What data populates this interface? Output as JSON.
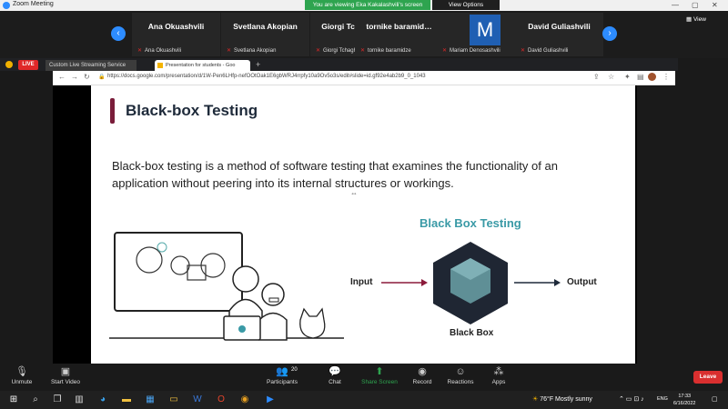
{
  "zoom": {
    "window_title": "Zoom Meeting",
    "viewing_banner": "You are viewing Eka Kakalashvili's screen",
    "view_options": "View Options",
    "view_label": "View",
    "leave_label": "Leave"
  },
  "participants": [
    {
      "name": "Ana Okuashvili",
      "sub": "Ana Okuashvili"
    },
    {
      "name": "Svetlana Akopian",
      "sub": "Svetlana Akopian"
    },
    {
      "name": "Giorgi Tchaghia…",
      "sub": "Giorgi Tchaghiashvili"
    },
    {
      "name": "tornike baramid…",
      "sub": "tornike baramidze"
    },
    {
      "name": "M",
      "sub": "Mariam Denosashvili"
    },
    {
      "name": "David Guliashvili",
      "sub": "David Guliashvili"
    }
  ],
  "browser": {
    "live_badge": "LIVE",
    "tab1_label": "Custom Live Streaming Service",
    "tab2_label": "Presentation for students - Goo",
    "url": "https://docs.google.com/presentation/d/1W-Pen6LHfp-nefOOtOak1E6gbWRJ4rrpfy10a9Ov5o3s/edit#slide=id.gf92e4ab2b9_0_1043"
  },
  "slide": {
    "title": "Black-box Testing",
    "body": "Black-box testing is a method of software testing that examines the functionality of an application without peering into its internal structures or workings.",
    "diagram_title": "Black Box Testing",
    "input_label": "Input",
    "output_label": "Output",
    "box_label": "Black Box",
    "colors": {
      "accent": "#7a1d3a",
      "diagram_title": "#3a9aa6",
      "input_arrow": "#8b1a3a",
      "output_arrow": "#1e2a3a"
    }
  },
  "toolbar": {
    "unmute": "Unmute",
    "start_video": "Start Video",
    "participants": "Participants",
    "participant_count": "20",
    "chat": "Chat",
    "share_screen": "Share Screen",
    "record": "Record",
    "reactions": "Reactions",
    "apps": "Apps"
  },
  "taskbar": {
    "weather": "76°F  Mostly sunny",
    "lang": "ENG",
    "time": "17:33",
    "date": "6/16/2022"
  }
}
